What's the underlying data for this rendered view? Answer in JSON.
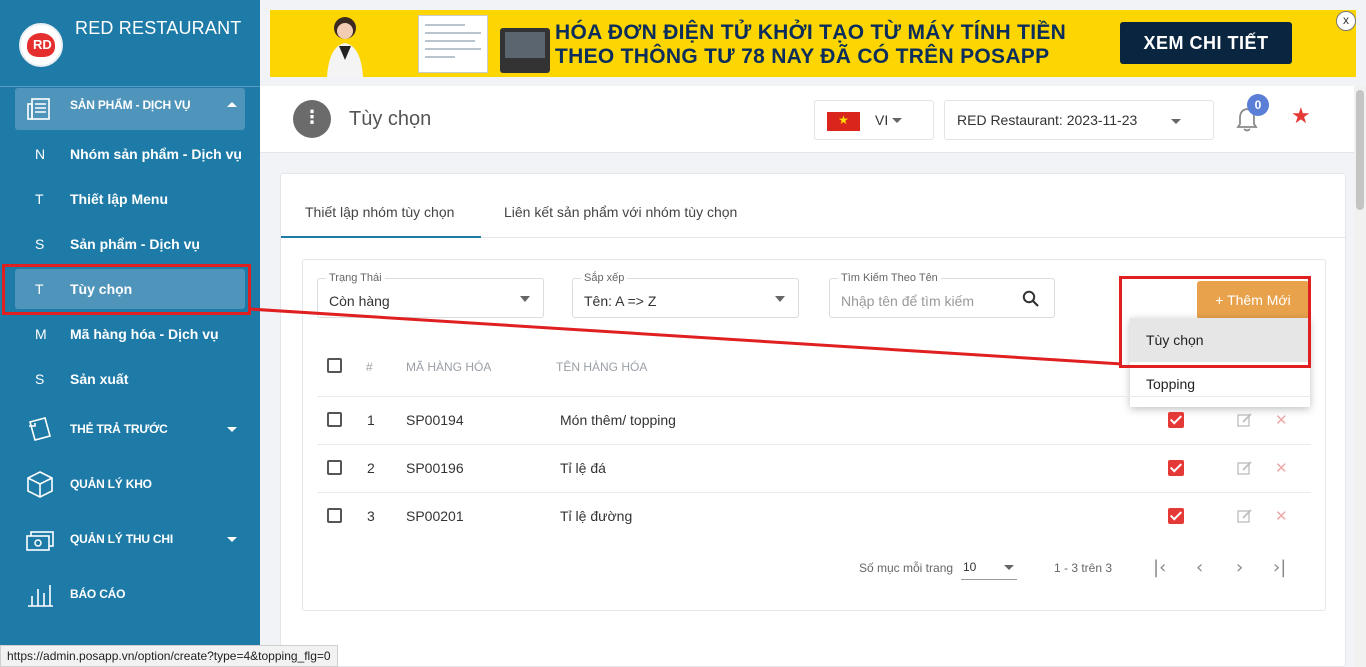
{
  "brand": {
    "name": "RED RESTAURANT",
    "logo_text": "RD"
  },
  "sidebar": {
    "group_products": "SẢN PHẨM - DỊCH VỤ",
    "items": [
      {
        "letter": "N",
        "label": "Nhóm sản phẩm - Dịch vụ"
      },
      {
        "letter": "T",
        "label": "Thiết lập Menu"
      },
      {
        "letter": "S",
        "label": "Sản phẩm - Dịch vụ"
      },
      {
        "letter": "T",
        "label": "Tùy chọn"
      },
      {
        "letter": "M",
        "label": "Mã hàng hóa - Dịch vụ"
      },
      {
        "letter": "S",
        "label": "Sản xuất"
      }
    ],
    "groups": [
      {
        "label": "THẺ TRẢ TRƯỚC",
        "icon": "prepaid-card-icon"
      },
      {
        "label": "QUẢN LÝ KHO",
        "icon": "warehouse-box-icon"
      },
      {
        "label": "QUẢN LÝ THU CHI",
        "icon": "cash-icon"
      },
      {
        "label": "BÁO CÁO",
        "icon": "report-chart-icon"
      }
    ]
  },
  "banner": {
    "line1": "HÓA ĐƠN ĐIỆN TỬ KHỞI TẠO TỪ MÁY TÍNH TIỀN",
    "line2": "THEO THÔNG TƯ 78 NAY ĐÃ CÓ TRÊN POSAPP",
    "cta": "XEM CHI TIẾT",
    "close": "x"
  },
  "header": {
    "title": "Tùy chọn",
    "lang": "VI",
    "store": "RED Restaurant: 2023-11-23",
    "notifications": "0"
  },
  "tabs": [
    {
      "label": "Thiết lập nhóm tùy chọn"
    },
    {
      "label": "Liên kết sản phẩm với nhóm tùy chọn"
    }
  ],
  "filters": {
    "status": {
      "label": "Trạng Thái",
      "value": "Còn hàng"
    },
    "sort": {
      "label": "Sắp xếp",
      "value": "Tên: A => Z"
    },
    "search": {
      "label": "Tìm Kiếm Theo Tên",
      "placeholder": "Nhập tên để tìm kiếm"
    }
  },
  "add_button": "+ Thêm Mới",
  "dropdown": [
    "Tùy chọn",
    "Topping"
  ],
  "table": {
    "headers": [
      "#",
      "MÃ HÀNG HÓA",
      "TÊN HÀNG HÓA"
    ],
    "rows": [
      {
        "num": "1",
        "code": "SP00194",
        "name": "Món thêm/ topping"
      },
      {
        "num": "2",
        "code": "SP00196",
        "name": "Tỉ lệ đá"
      },
      {
        "num": "3",
        "code": "SP00201",
        "name": "Tỉ lệ đường"
      }
    ]
  },
  "pagination": {
    "per_page_label": "Số mục mỗi trang",
    "per_page": "10",
    "range": "1 - 3 trên 3"
  },
  "status_url": "https://admin.posapp.vn/option/create?type=4&topping_flg=0",
  "colors": {
    "sidebar": "#1e7ba8",
    "accent_orange": "#e8a24c",
    "annotation_red": "#e02020",
    "banner_yellow": "#fdd500"
  }
}
